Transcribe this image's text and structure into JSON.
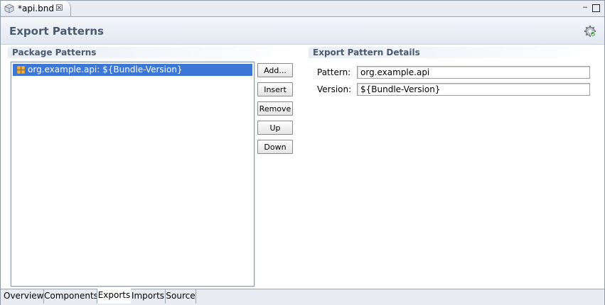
{
  "editor_tab": {
    "title": "*api.bnd",
    "file_icon": "bnd-file-icon",
    "close_icon": "close-icon"
  },
  "window_controls": {
    "minimize": "minimize-icon",
    "maximize": "maximize-icon"
  },
  "form": {
    "title": "Export Patterns",
    "action_icon": "gear-icon"
  },
  "package_patterns": {
    "title": "Package Patterns",
    "items": [
      {
        "label": "org.example.api: ${Bundle-Version}",
        "icon": "package-icon",
        "selected": true
      }
    ],
    "buttons": {
      "add": "Add...",
      "insert": "Insert",
      "remove": "Remove",
      "up": "Up",
      "down": "Down"
    }
  },
  "details": {
    "title": "Export Pattern Details",
    "pattern_label": "Pattern:",
    "pattern_value": "org.example.api",
    "version_label": "Version:",
    "version_value": "${Bundle-Version}"
  },
  "page_tabs": [
    {
      "label": "Overview",
      "active": false
    },
    {
      "label": "Components",
      "active": false
    },
    {
      "label": "Exports",
      "active": true
    },
    {
      "label": "Imports",
      "active": false
    },
    {
      "label": "Source",
      "active": false
    }
  ]
}
